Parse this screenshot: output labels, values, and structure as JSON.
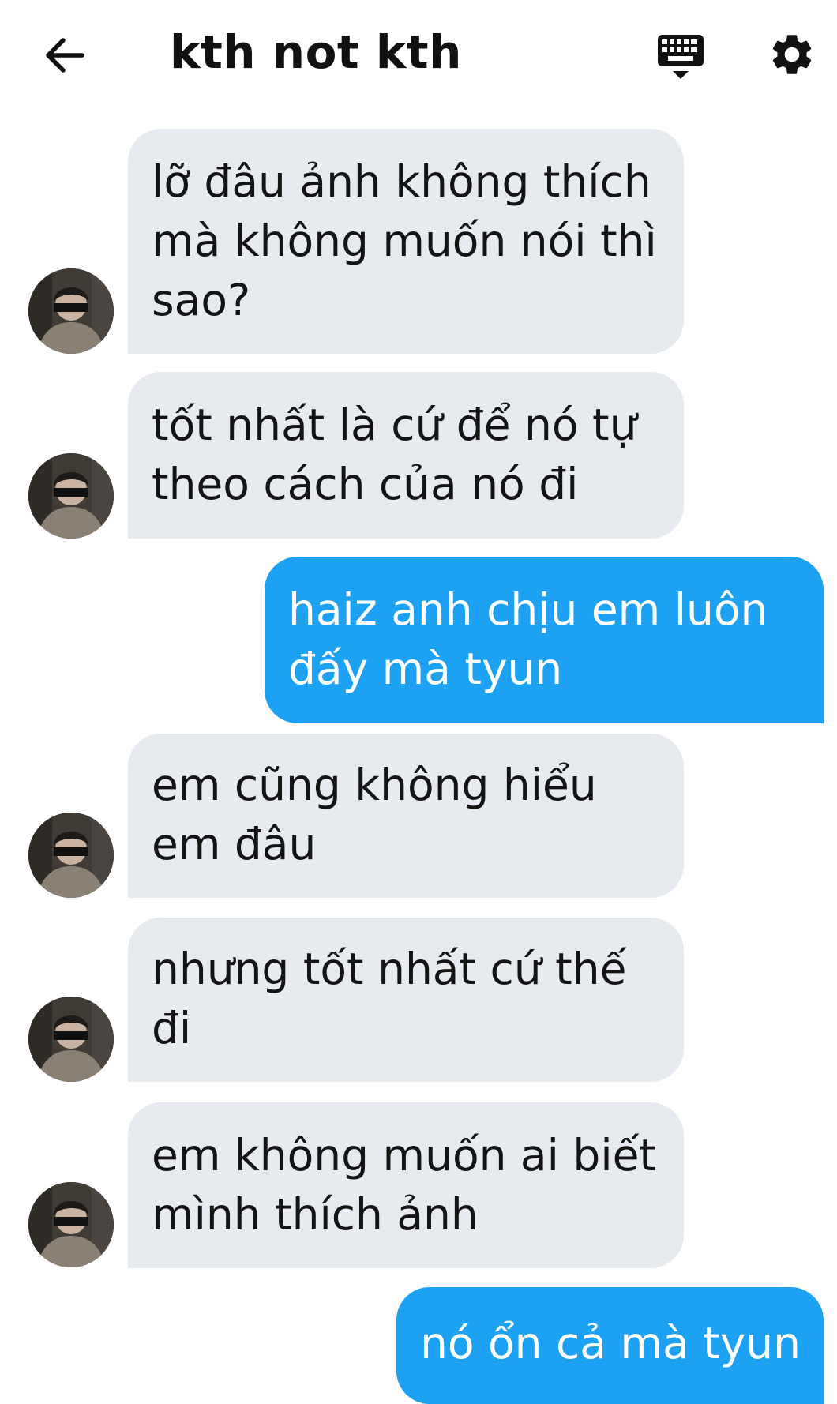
{
  "header": {
    "title": "kth not kth",
    "back_icon": "arrow-left-icon",
    "keyboard_icon": "keyboard-icon",
    "settings_icon": "gear-icon"
  },
  "colors": {
    "incoming_bubble": "#e7ebf0",
    "outgoing_bubble": "#1da1f2",
    "outgoing_text": "#ffffff"
  },
  "messages": [
    {
      "dir": "in",
      "lines": [
        "lỡ đâu ảnh không thích",
        "mà không muốn nói thì",
        "sao?"
      ]
    },
    {
      "dir": "in",
      "lines": [
        "tốt nhất là cứ để nó tự",
        "theo cách của nó đi"
      ]
    },
    {
      "dir": "out",
      "lines": [
        "haiz anh chịu em luôn",
        "đấy mà tyun"
      ]
    },
    {
      "dir": "in",
      "lines": [
        "em cũng không hiểu",
        "em đâu"
      ]
    },
    {
      "dir": "in",
      "lines": [
        "nhưng tốt nhất cứ thế",
        "đi"
      ]
    },
    {
      "dir": "in",
      "lines": [
        "em không muốn ai biết",
        "mình thích ảnh"
      ]
    },
    {
      "dir": "out",
      "lines": [
        "nó ổn cả mà tyun"
      ]
    }
  ]
}
